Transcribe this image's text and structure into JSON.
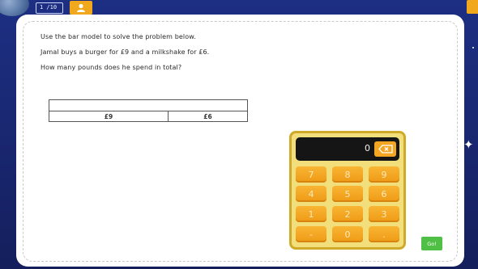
{
  "header": {
    "progress": "1 /10"
  },
  "question": {
    "lines": [
      "Use the bar model to solve the problem below.",
      "Jamal buys a burger for £9 and a milkshake for £6.",
      "How many pounds does he spend in total?"
    ]
  },
  "bar_model": {
    "parts": [
      "£9",
      "£6"
    ]
  },
  "calculator": {
    "display": "0",
    "keys": [
      "7",
      "8",
      "9",
      "4",
      "5",
      "6",
      "1",
      "2",
      "3",
      "-",
      "0",
      "."
    ]
  },
  "go_label": "Go!",
  "colors": {
    "background": "#1d2f83",
    "key": "#f4a623",
    "calculator_body": "#f3de7c",
    "go": "#4fbf45"
  },
  "icons": [
    "globe-icon",
    "avatar-icon",
    "backspace-icon",
    "star-icon"
  ]
}
